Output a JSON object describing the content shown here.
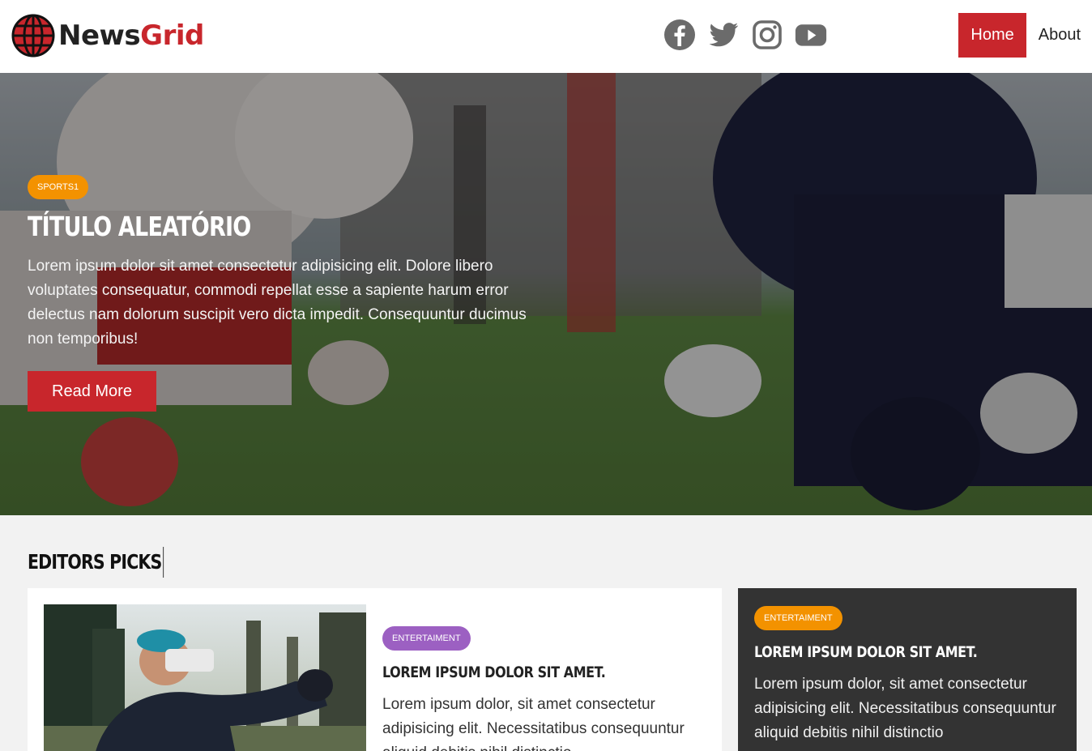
{
  "brand": {
    "name_part1": "News",
    "name_part2": "Grid"
  },
  "social": [
    "facebook-icon",
    "twitter-icon",
    "instagram-icon",
    "youtube-icon"
  ],
  "nav": {
    "home": "Home",
    "about": "About"
  },
  "hero": {
    "badge": "sports1",
    "title": "Título Aleatório",
    "text": "Lorem ipsum dolor sit amet consectetur adipisicing elit. Dolore libero voluptates consequatur, commodi repellat esse a sapiente harum error delectus nam dolorum suscipit vero dicta impedit. Consequuntur ducimus non temporibus!",
    "button": "Read More"
  },
  "editors": {
    "title": "Editors Picks",
    "main_card": {
      "badge": "entertaiment",
      "title": "Lorem ipsum dolor sit amet.",
      "text": "Lorem ipsum dolor, sit amet consectetur adipisicing elit. Necessitatibus consequuntur aliquid debitis nihil distinctio"
    },
    "side_card": {
      "badge": "entertaiment",
      "title": "Lorem ipsum dolor sit amet.",
      "text": "Lorem ipsum dolor, sit amet consectetur adipisicing elit. Necessitatibus consequuntur aliquid debitis nihil distinctio"
    }
  },
  "colors": {
    "brand_red": "#c8262c",
    "badge_orange": "#f39200",
    "badge_purple": "#9c60c2",
    "dark_card": "#333333"
  }
}
